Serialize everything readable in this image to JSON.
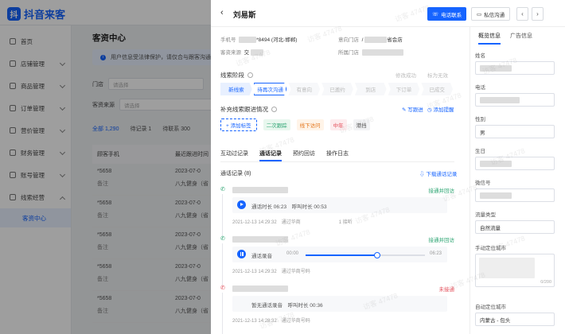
{
  "app": {
    "logo_text": "抖音来客",
    "logo_mark": "抖"
  },
  "sidebar": {
    "items": [
      {
        "label": "首页"
      },
      {
        "label": "店铺管理"
      },
      {
        "label": "商品管理"
      },
      {
        "label": "订单管理"
      },
      {
        "label": "营价管理"
      },
      {
        "label": "财务管理"
      },
      {
        "label": "账号管理"
      },
      {
        "label": "线索经营"
      }
    ],
    "sub_active": "客资中心"
  },
  "main": {
    "title": "客资中心",
    "notice": "用户信息受法律保护，请仅合与跟客沟通",
    "filters": [
      {
        "label": "门店",
        "placeholder": "请选择"
      },
      {
        "label": "客资来源",
        "placeholder": "请选择"
      }
    ],
    "tabs": [
      {
        "label": "全部 1,290",
        "active": true
      },
      {
        "label": "待记录 1"
      },
      {
        "label": "待联系 300"
      }
    ],
    "table": {
      "headers": [
        "顾客手机",
        "最近跟进时间"
      ],
      "rows": [
        {
          "phone": "*5658",
          "sub": "备注",
          "date": "2023-07-0",
          "store": "八九健身（省"
        },
        {
          "phone": "*5658",
          "sub": "备注",
          "date": "2023-07-0",
          "store": "八九健身（省"
        },
        {
          "phone": "*5658",
          "sub": "备注",
          "date": "2023-07-0",
          "store": "八九健身（省"
        },
        {
          "phone": "*5658",
          "sub": "备注",
          "date": "2023-07-0",
          "store": "八九健身（省"
        },
        {
          "phone": "*5658",
          "sub": "备注",
          "date": "2023-07-0",
          "store": "八九健身（省"
        }
      ]
    }
  },
  "drawer": {
    "back_glyph": "‹",
    "name": "刘易斯",
    "call_button": "电话联系",
    "chat_button": "私信沟通",
    "prev": "‹",
    "next": "›",
    "info": {
      "phone_label": "手机号",
      "phone_value": "*8494 (河北-邯郸)",
      "store_label": "意向门店",
      "store_value": "省会店",
      "source_label": "客资来源",
      "source_value": "交",
      "owner_label": "所属门店",
      "owner_value": ""
    },
    "stage_title": "线索阶段",
    "stage_opts": [
      "修改成功",
      "标为无效"
    ],
    "stages": [
      {
        "label": "新线索",
        "state": "done"
      },
      {
        "label": "待再次沟通",
        "state": "cur"
      },
      {
        "label": "有意向",
        "state": "todo"
      },
      {
        "label": "已邀约",
        "state": "todo"
      },
      {
        "label": "到店",
        "state": "todo"
      },
      {
        "label": "下订单",
        "state": "todo"
      },
      {
        "label": "已成交",
        "state": "todo"
      }
    ],
    "supplement_title": "补充线索跟进情况",
    "write_link": "写跟进",
    "more_link": "添加提醒",
    "add_tag": "+ 添加标签",
    "tags": [
      {
        "label": "二次跟踪",
        "color": "#2ba471",
        "bg": "#e8f7ee"
      },
      {
        "label": "线下访问",
        "color": "#e37318",
        "bg": "#fff4e8"
      },
      {
        "label": "中年",
        "color": "#e34d59",
        "bg": "#fdecee"
      },
      {
        "label": "港挡",
        "color": "#555555",
        "bg": "#f2f3f5"
      }
    ],
    "tabs": [
      {
        "label": "互动过记录"
      },
      {
        "label": "通话记录",
        "active": true
      },
      {
        "label": "预约回访"
      },
      {
        "label": "操作日志"
      }
    ],
    "records_title": "通话记录 (8)",
    "download": "下载通话记录",
    "records": [
      {
        "status": "接通并回访",
        "status_color": "#2ba471",
        "player": "play",
        "line1": "通话时长 06:23　呼叫时长 00:53",
        "meta": "2021-12-13 14:29:32　通过华商　　　　　　　　1 接听"
      },
      {
        "status": "接通并回访",
        "status_color": "#2ba471",
        "player": "pause",
        "line1": "通话录音",
        "start": "00:00",
        "end": "06:23",
        "progress": 0.6,
        "meta": "2021-12-13 14:29:32　通过华商号码"
      },
      {
        "status": "未接通",
        "status_color": "#e34d59",
        "player": "none",
        "line1": "暂无通话录音　呼叫时长 00:36",
        "meta": "2021-12-13 14:28:32　通过华商号码"
      }
    ],
    "right_panel": {
      "tabs": [
        {
          "label": "概览信息",
          "active": true
        },
        {
          "label": "广告信息"
        }
      ],
      "fields": [
        {
          "label": "姓名",
          "value": ""
        },
        {
          "label": "电话",
          "value": ""
        },
        {
          "label": "性别",
          "value": "男"
        },
        {
          "label": "生日",
          "value": ""
        },
        {
          "label": "微信号",
          "value": ""
        },
        {
          "label": "流量类型",
          "value": "自然流量"
        }
      ],
      "textarea_label": "手动定位城市",
      "textarea_count": "0/200",
      "auto_label": "自动定位城市",
      "auto_value": "内蒙古 - 包头"
    },
    "watermark": "访客 47478"
  }
}
